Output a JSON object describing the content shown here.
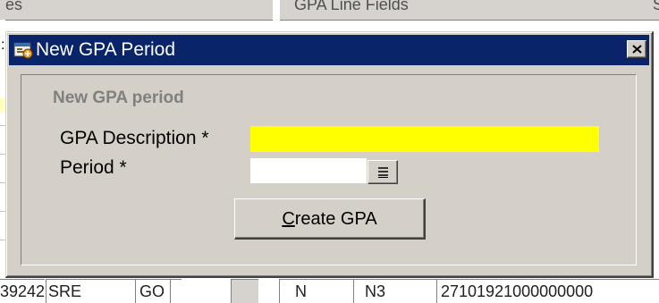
{
  "background": {
    "header_left": "es",
    "header_mid": "GPA Line Fields",
    "header_right": "S",
    "left_colon": ":",
    "row": {
      "id": "39242",
      "code": "SRE",
      "type": "GO",
      "flag": "N",
      "level": "N3",
      "number": "27101921000000000"
    }
  },
  "dialog": {
    "title": "New GPA Period",
    "section_title": "New GPA period",
    "fields": {
      "description_label": "GPA Description *",
      "description_value": "",
      "period_label": "Period *",
      "period_value": ""
    },
    "create_button": {
      "mnemonic": "C",
      "rest": "reate GPA"
    }
  },
  "colors": {
    "titlebar": "#0a246a",
    "required_field": "#ffff00",
    "dialog_face": "#d4d0c8"
  },
  "icons": {
    "title": "oracle-forms-window-icon",
    "close": "close-icon",
    "lov": "list-of-values-icon"
  }
}
